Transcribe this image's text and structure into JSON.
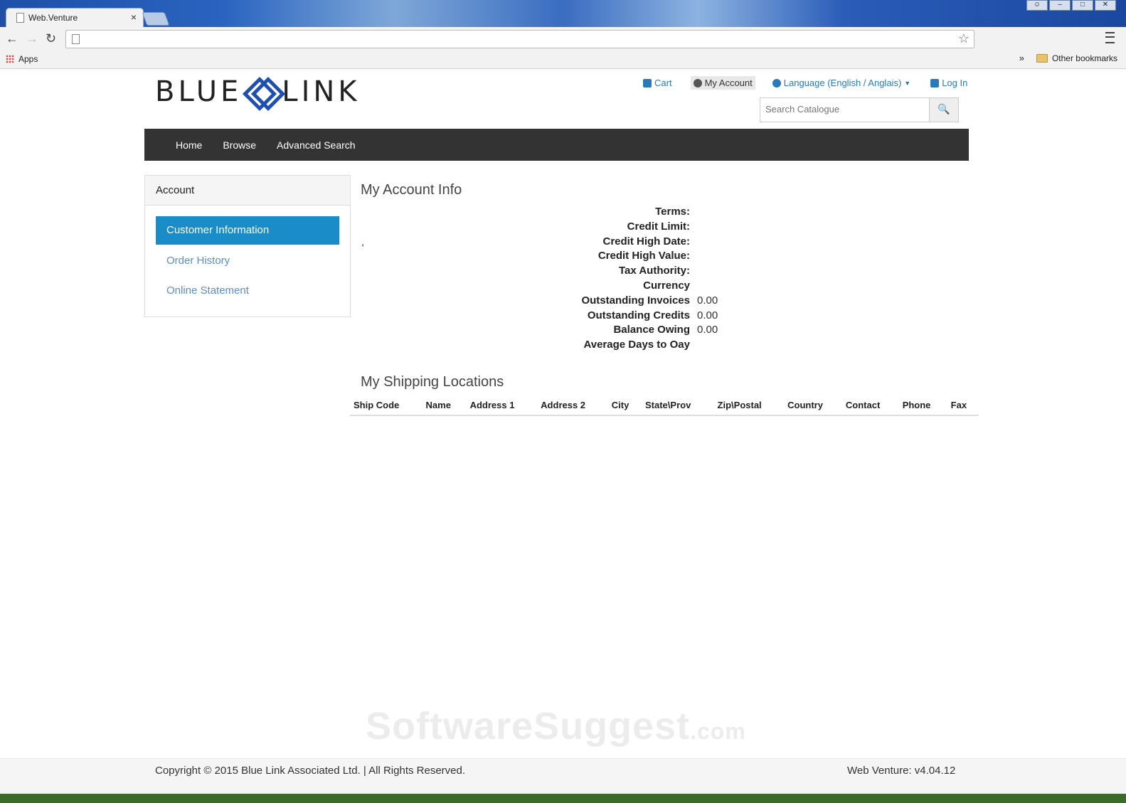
{
  "browser": {
    "tab_title": "Web.Venture",
    "tab_close": "×",
    "bookmarks": {
      "apps_label": "Apps",
      "overflow": "»",
      "other_label": "Other bookmarks"
    }
  },
  "header": {
    "logo_left": "BLUE",
    "logo_right": "LINK",
    "links": {
      "cart": "Cart",
      "account": "My Account",
      "language": "Language (English / Anglais)",
      "login": "Log In"
    },
    "search_placeholder": "Search Catalogue"
  },
  "nav": {
    "home": "Home",
    "browse": "Browse",
    "advanced": "Advanced Search"
  },
  "sidebar": {
    "title": "Account",
    "items": [
      {
        "label": "Customer Information"
      },
      {
        "label": "Order History"
      },
      {
        "label": "Online Statement"
      }
    ]
  },
  "account_info": {
    "title": "My Account Info",
    "stray_text": ",",
    "rows": [
      {
        "label": "Terms:",
        "value": ""
      },
      {
        "label": "Credit Limit:",
        "value": ""
      },
      {
        "label": "Credit High Date:",
        "value": ""
      },
      {
        "label": "Credit High Value:",
        "value": ""
      },
      {
        "label": "Tax Authority:",
        "value": ""
      },
      {
        "label": "Currency",
        "value": ""
      },
      {
        "label": "Outstanding Invoices",
        "value": "0.00"
      },
      {
        "label": "Outstanding Credits",
        "value": "0.00"
      },
      {
        "label": "Balance Owing",
        "value": "0.00"
      },
      {
        "label": "Average Days to Oay",
        "value": ""
      }
    ]
  },
  "shipping": {
    "title": "My Shipping Locations",
    "columns": [
      "Ship Code",
      "Name",
      "Address 1",
      "Address 2",
      "City",
      "State\\Prov",
      "Zip\\Postal",
      "Country",
      "Contact",
      "Phone",
      "Fax"
    ]
  },
  "watermark": {
    "main": "SoftwareSuggest",
    "suffix": ".com"
  },
  "footer": {
    "copyright": "Copyright © 2015 Blue Link Associated Ltd. | All Rights Reserved.",
    "version": "Web Venture: v4.04.12"
  }
}
